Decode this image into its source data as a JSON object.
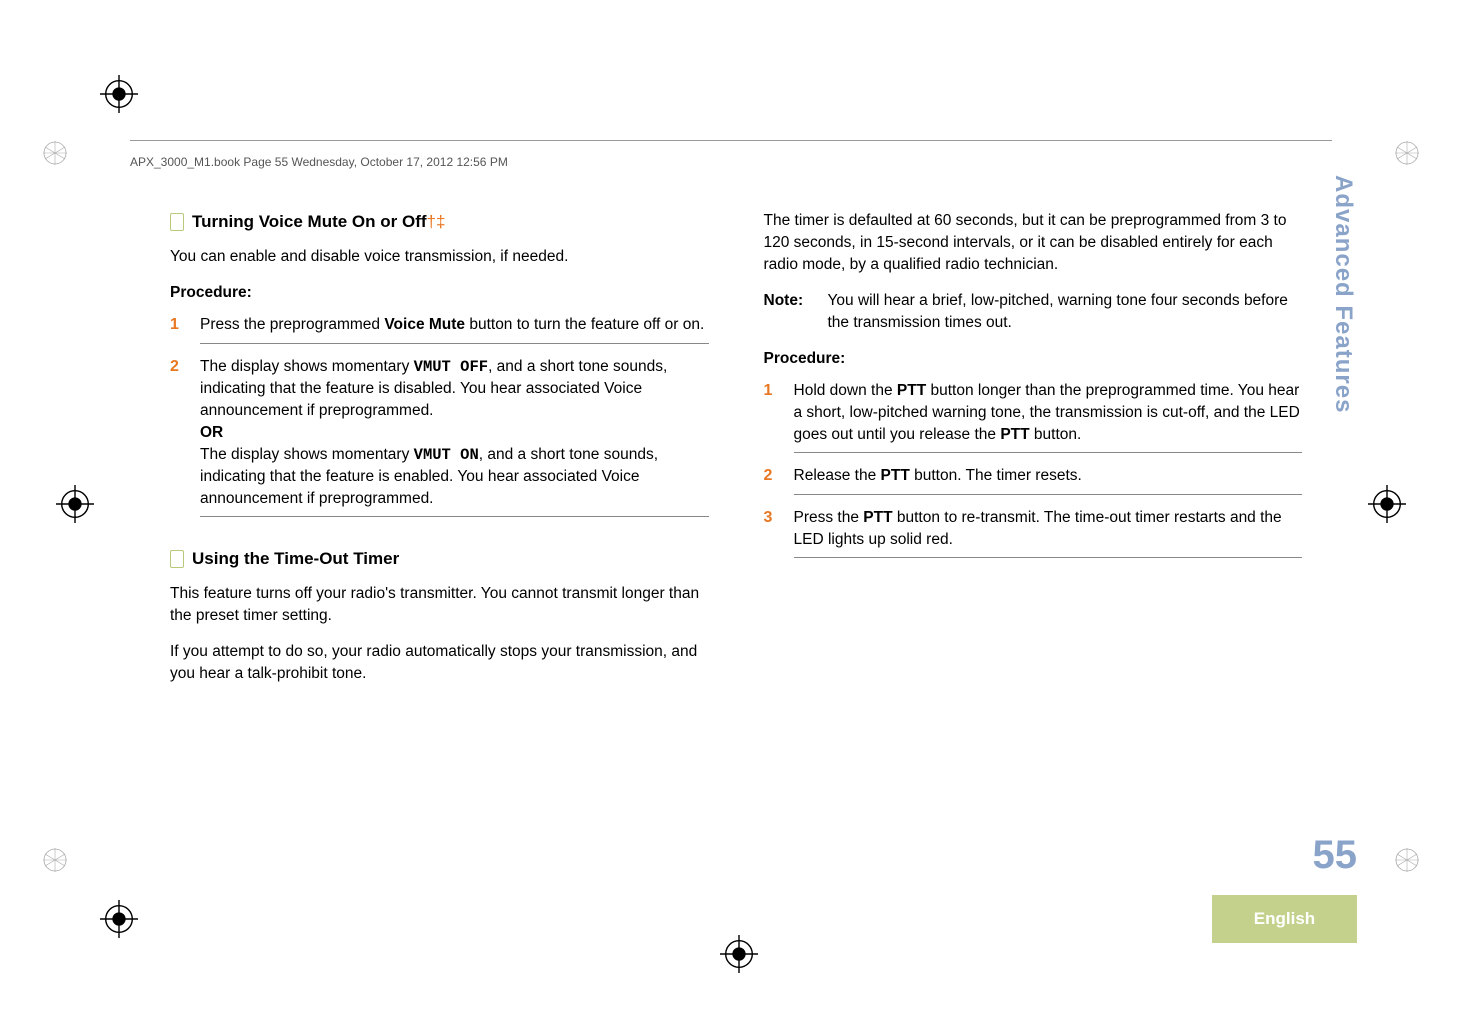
{
  "header_text": "APX_3000_M1.book  Page 55  Wednesday, October 17, 2012  12:56 PM",
  "left": {
    "h1": "Turning Voice Mute On or Off",
    "h1_symbols": "†‡",
    "p1": "You can enable and disable voice transmission, if needed.",
    "proc": "Procedure:",
    "s1_num": "1",
    "s1_a": "Press the preprogrammed ",
    "s1_b": "Voice Mute",
    "s1_c": " button to turn the feature off or on.",
    "s2_num": "2",
    "s2_a": "The display shows momentary ",
    "s2_b": "VMUT OFF",
    "s2_c": ", and a short tone sounds, indicating that the feature is disabled. You hear associated Voice announcement if preprogrammed.",
    "s2_or": "OR",
    "s2_d": "The display shows momentary ",
    "s2_e": "VMUT ON",
    "s2_f": ", and a short tone sounds, indicating that the feature is enabled. You hear associated Voice announcement if preprogrammed.",
    "h2": "Using the Time-Out Timer",
    "p2": "This feature turns off your radio's transmitter. You cannot transmit longer than the preset timer setting.",
    "p3": "If you attempt to do so, your radio automatically stops your transmission, and you hear a talk-prohibit tone."
  },
  "right": {
    "p1": "The timer is defaulted at 60 seconds, but it can be preprogrammed from 3 to 120 seconds, in 15-second intervals, or it can be disabled entirely for each radio mode, by a qualified radio technician.",
    "note_label": "Note:",
    "note_body": "You will hear a brief, low-pitched, warning tone four seconds before the transmission times out.",
    "proc": "Procedure:",
    "s1_num": "1",
    "s1_a": "Hold down the ",
    "s1_b": "PTT",
    "s1_c": " button longer than the preprogrammed time. You hear a short, low-pitched warning tone, the transmission is cut-off, and the LED goes out until you release the ",
    "s1_d": "PTT",
    "s1_e": " button.",
    "s2_num": "2",
    "s2_a": "Release the ",
    "s2_b": "PTT",
    "s2_c": " button. The timer resets.",
    "s3_num": "3",
    "s3_a": "Press the ",
    "s3_b": "PTT",
    "s3_c": " button to re-transmit. The time-out timer restarts and the LED lights up solid red."
  },
  "side_tab": "Advanced Features",
  "page_number": "55",
  "language": "English"
}
